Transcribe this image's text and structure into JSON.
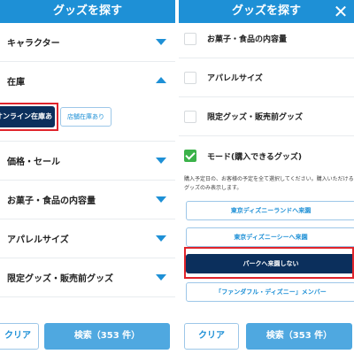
{
  "left": {
    "header_title": "グッズを探す",
    "close_symbol": "✕",
    "rows": [
      {
        "label": "キャラクター"
      },
      {
        "label": "在庫"
      },
      {
        "label": "価格・セール"
      },
      {
        "label": "お菓子・食品の内容量"
      },
      {
        "label": "アパレルサイズ"
      },
      {
        "label": "限定グッズ・販売前グッズ"
      }
    ],
    "stock_buttons": {
      "online": "オンライン在庫あり",
      "store": "店舗在庫あり"
    },
    "footer": {
      "clear": "クリア",
      "search": "検索（353 件）"
    }
  },
  "right": {
    "header_title": "グッズを探す",
    "checks": [
      {
        "label": "お菓子・食品の内容量",
        "checked": false
      },
      {
        "label": "アパレルサイズ",
        "checked": false
      },
      {
        "label": "限定グッズ・販売前グッズ",
        "checked": false
      },
      {
        "label": "モード(購入できるグッズ)",
        "checked": true
      }
    ],
    "note": "購入予定日の、お客様の予定を全て選択してください。購入いただけるグッズのみ表示します。",
    "options": [
      {
        "label": "東京ディズニーランドへ来園",
        "selected": false
      },
      {
        "label": "東京ディズニーシーへ来園",
        "selected": false
      },
      {
        "label": "パークへ来園しない",
        "selected": true
      },
      {
        "label": "「ファンダフル・ディズニー」メンバー",
        "selected": false
      }
    ],
    "footer": {
      "clear": "クリア",
      "search": "検索（353 件）"
    }
  },
  "colors": {
    "header_blue": "#1e90d6",
    "navy": "#0b2f5c",
    "highlight_red": "#e0242b",
    "check_green": "#3bb24a"
  }
}
